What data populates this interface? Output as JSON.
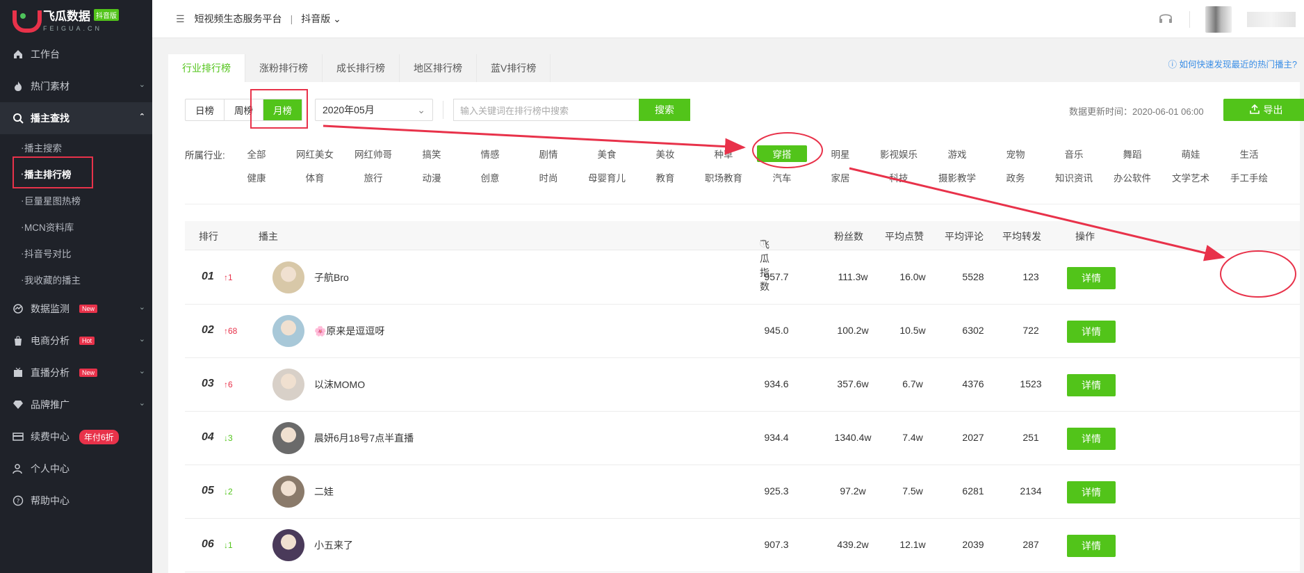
{
  "sidebar": {
    "logo": {
      "title": "飞瓜数据",
      "badge": "抖音版",
      "sub": "FEIGUA.CN"
    },
    "items": [
      {
        "label": "工作台",
        "icon": "home-icon"
      },
      {
        "label": "热门素材",
        "icon": "fire-icon"
      },
      {
        "label": "播主查找",
        "icon": "search-icon"
      }
    ],
    "sub_items": [
      "播主搜索",
      "播主排行榜",
      "巨量星图热榜",
      "MCN资料库",
      "抖音号对比",
      "我收藏的播主"
    ],
    "items2": [
      {
        "label": "数据监测",
        "badge": "New",
        "icon": "monitor-icon"
      },
      {
        "label": "电商分析",
        "badge": "Hot",
        "icon": "bag-icon"
      },
      {
        "label": "直播分析",
        "badge": "New",
        "icon": "live-icon"
      },
      {
        "label": "品牌推广",
        "icon": "diamond-icon"
      },
      {
        "label": "续费中心",
        "badge": "年付6折",
        "icon": "card-icon"
      },
      {
        "label": "个人中心",
        "icon": "user-icon"
      },
      {
        "label": "帮助中心",
        "icon": "help-icon"
      }
    ]
  },
  "header": {
    "platform": "短视频生态服务平台",
    "separator": "|",
    "version": "抖音版"
  },
  "tabs": [
    "行业排行榜",
    "涨粉排行榜",
    "成长排行榜",
    "地区排行榜",
    "蓝V排行榜"
  ],
  "help_link": "如何快速发现最近的热门播主?",
  "filters": {
    "periods": [
      "日榜",
      "周榜",
      "月榜"
    ],
    "month": "2020年05月",
    "search_placeholder": "输入关键词在排行榜中搜索",
    "search_button": "搜索",
    "update_time": "数据更新时间：2020-06-01 06:00",
    "export": "导出"
  },
  "industry": {
    "label": "所属行业:",
    "options": [
      "全部",
      "网红美女",
      "网红帅哥",
      "搞笑",
      "情感",
      "剧情",
      "美食",
      "美妆",
      "种草",
      "穿搭",
      "明星",
      "影视娱乐",
      "游戏",
      "宠物",
      "音乐",
      "舞蹈",
      "萌娃",
      "生活",
      "健康",
      "体育",
      "旅行",
      "动漫",
      "创意",
      "时尚",
      "母婴育儿",
      "教育",
      "职场教育",
      "汽车",
      "家居",
      "科技",
      "摄影教学",
      "政务",
      "知识资讯",
      "办公软件",
      "文学艺术",
      "手工手绘"
    ],
    "selected": "穿搭"
  },
  "table": {
    "headers": {
      "rank": "排行",
      "streamer": "播主",
      "index": "飞瓜指数",
      "fans": "粉丝数",
      "likes": "平均点赞",
      "comments": "平均评论",
      "shares": "平均转发",
      "action": "操作"
    },
    "rows": [
      {
        "rank": "01",
        "trend": "↑1",
        "dir": "up",
        "name": "子航Bro",
        "index": "957.7",
        "fans": "111.3w",
        "likes": "16.0w",
        "comments": "5528",
        "shares": "123",
        "action": "详情"
      },
      {
        "rank": "02",
        "trend": "↑68",
        "dir": "up",
        "name": "🌸原来是逗逗呀",
        "index": "945.0",
        "fans": "100.2w",
        "likes": "10.5w",
        "comments": "6302",
        "shares": "722",
        "action": "详情"
      },
      {
        "rank": "03",
        "trend": "↑6",
        "dir": "up",
        "name": "以沫MOMO",
        "index": "934.6",
        "fans": "357.6w",
        "likes": "6.7w",
        "comments": "4376",
        "shares": "1523",
        "action": "详情"
      },
      {
        "rank": "04",
        "trend": "↓3",
        "dir": "down",
        "name": "晨妍6月18号7点半直播",
        "index": "934.4",
        "fans": "1340.4w",
        "likes": "7.4w",
        "comments": "2027",
        "shares": "251",
        "action": "详情"
      },
      {
        "rank": "05",
        "trend": "↓2",
        "dir": "down",
        "name": "二娃",
        "index": "925.3",
        "fans": "97.2w",
        "likes": "7.5w",
        "comments": "6281",
        "shares": "2134",
        "action": "详情"
      },
      {
        "rank": "06",
        "trend": "↓1",
        "dir": "down",
        "name": "小五来了",
        "index": "907.3",
        "fans": "439.2w",
        "likes": "12.1w",
        "comments": "2039",
        "shares": "287",
        "action": "详情"
      }
    ]
  },
  "colors": {
    "accent": "#52c41a",
    "annotation": "#e8324a",
    "sidebar_bg": "#1f2229"
  }
}
